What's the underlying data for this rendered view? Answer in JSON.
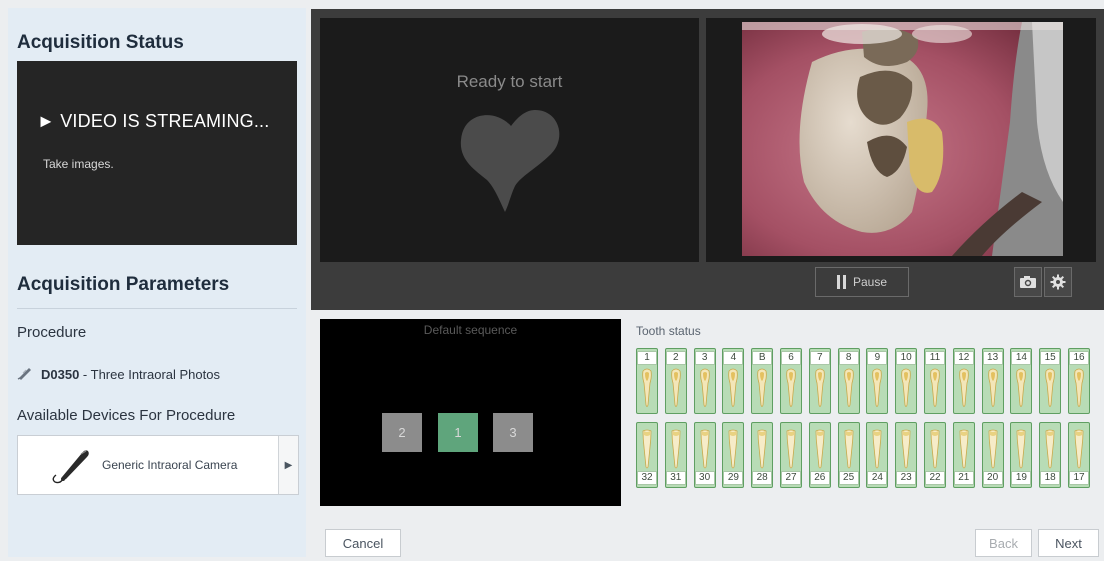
{
  "acquisition_status": {
    "title": "Acquisition Status",
    "status_text": "► VIDEO IS STREAMING...",
    "instruction": "Take images."
  },
  "acquisition_parameters": {
    "title": "Acquisition Parameters",
    "procedure_label": "Procedure",
    "procedure_code": "D0350",
    "procedure_desc": " - Three Intraoral Photos",
    "devices_label": "Available Devices For Procedure",
    "device_name": "Generic Intraoral Camera"
  },
  "viewer": {
    "ready_text": "Ready to start",
    "pause_label": "Pause",
    "camera_icon": "camera-icon",
    "settings_icon": "gear-icon"
  },
  "sequence": {
    "title": "Default sequence",
    "steps": [
      {
        "label": "2",
        "state": "inactive"
      },
      {
        "label": "1",
        "state": "active"
      },
      {
        "label": "3",
        "state": "inactive"
      }
    ]
  },
  "tooth_status": {
    "title": "Tooth status",
    "upper": [
      "1",
      "2",
      "3",
      "4",
      "B",
      "6",
      "7",
      "8",
      "9",
      "10",
      "11",
      "12",
      "13",
      "14",
      "15",
      "16"
    ],
    "lower": [
      "32",
      "31",
      "30",
      "29",
      "28",
      "27",
      "26",
      "25",
      "24",
      "23",
      "22",
      "21",
      "20",
      "19",
      "18",
      "17"
    ]
  },
  "footer": {
    "cancel": "Cancel",
    "back": "Back",
    "next": "Next"
  },
  "colors": {
    "active_step": "#5fa57c",
    "inactive_step": "#8c8c8c",
    "tooth_fill": "#b8dcb6"
  }
}
